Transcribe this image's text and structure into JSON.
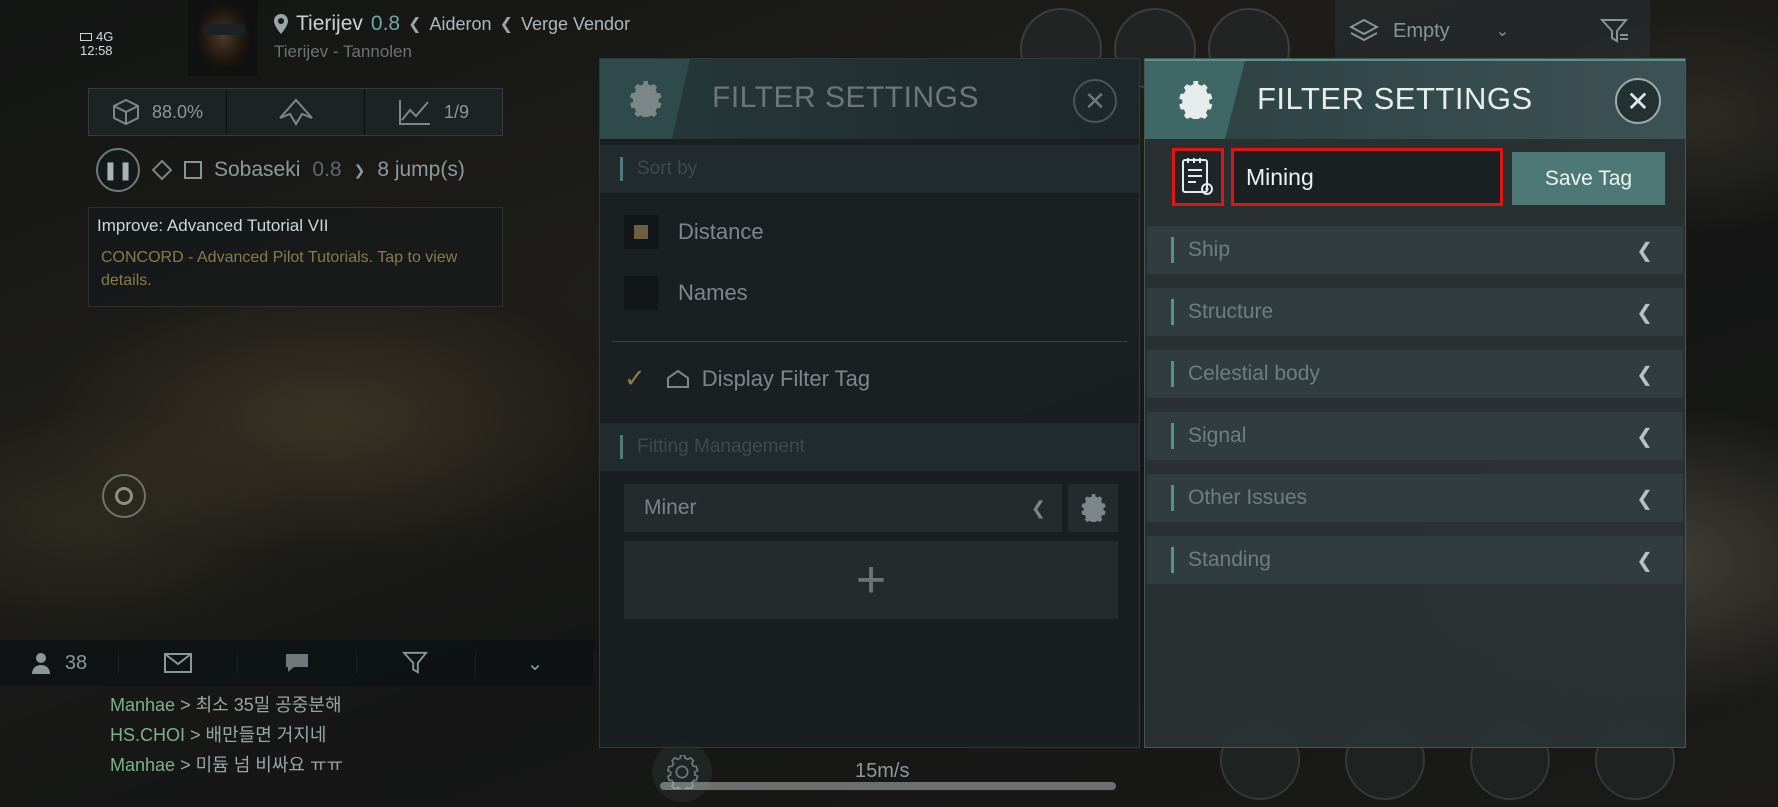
{
  "status": {
    "network": "4G",
    "time": "12:58"
  },
  "location": {
    "system": "Tierijev",
    "security": "0.8",
    "crumbs": [
      "Aideron",
      "Verge Vendor"
    ],
    "sub": "Tierijev - Tannolen"
  },
  "stats": {
    "cargo": "88.0%",
    "progress": "1/9"
  },
  "destination": {
    "name": "Sobaseki",
    "security": "0.8",
    "jumps": "8 jump(s)"
  },
  "mission": {
    "title": "Improve: Advanced Tutorial VII",
    "detail": "CONCORD - Advanced Pilot Tutorials. Tap to view details."
  },
  "chat": {
    "online_count": "38",
    "lines": [
      {
        "nick": "Manhae",
        "msg": "> 최소 35밀 공중분해"
      },
      {
        "nick": "HS.CHOI",
        "msg": "> 배만들면 거지네"
      },
      {
        "nick": "Manhae",
        "msg": "> 미듐 넘 비싸요 ㅠㅠ"
      }
    ]
  },
  "overview": {
    "selected": "Empty"
  },
  "hud": {
    "speed": "15m/s"
  },
  "filter_panel_back": {
    "title": "FILTER SETTINGS",
    "sort_by": "Sort by",
    "options": [
      "Distance",
      "Names"
    ],
    "display_tag": "Display Filter Tag",
    "fitting_header": "Fitting Management",
    "fitting_selected": "Miner",
    "add_symbol": "+"
  },
  "filter_panel": {
    "title": "FILTER SETTINGS",
    "tag_value": "Mining",
    "save_label": "Save Tag",
    "categories": [
      "Ship",
      "Structure",
      "Celestial body",
      "Signal",
      "Other Issues",
      "Standing"
    ]
  },
  "colors": {
    "accent": "#4d7875",
    "highlight_box": "#e11414",
    "security_green": "#6fa89e",
    "chat_nick": "#7fb08a"
  }
}
